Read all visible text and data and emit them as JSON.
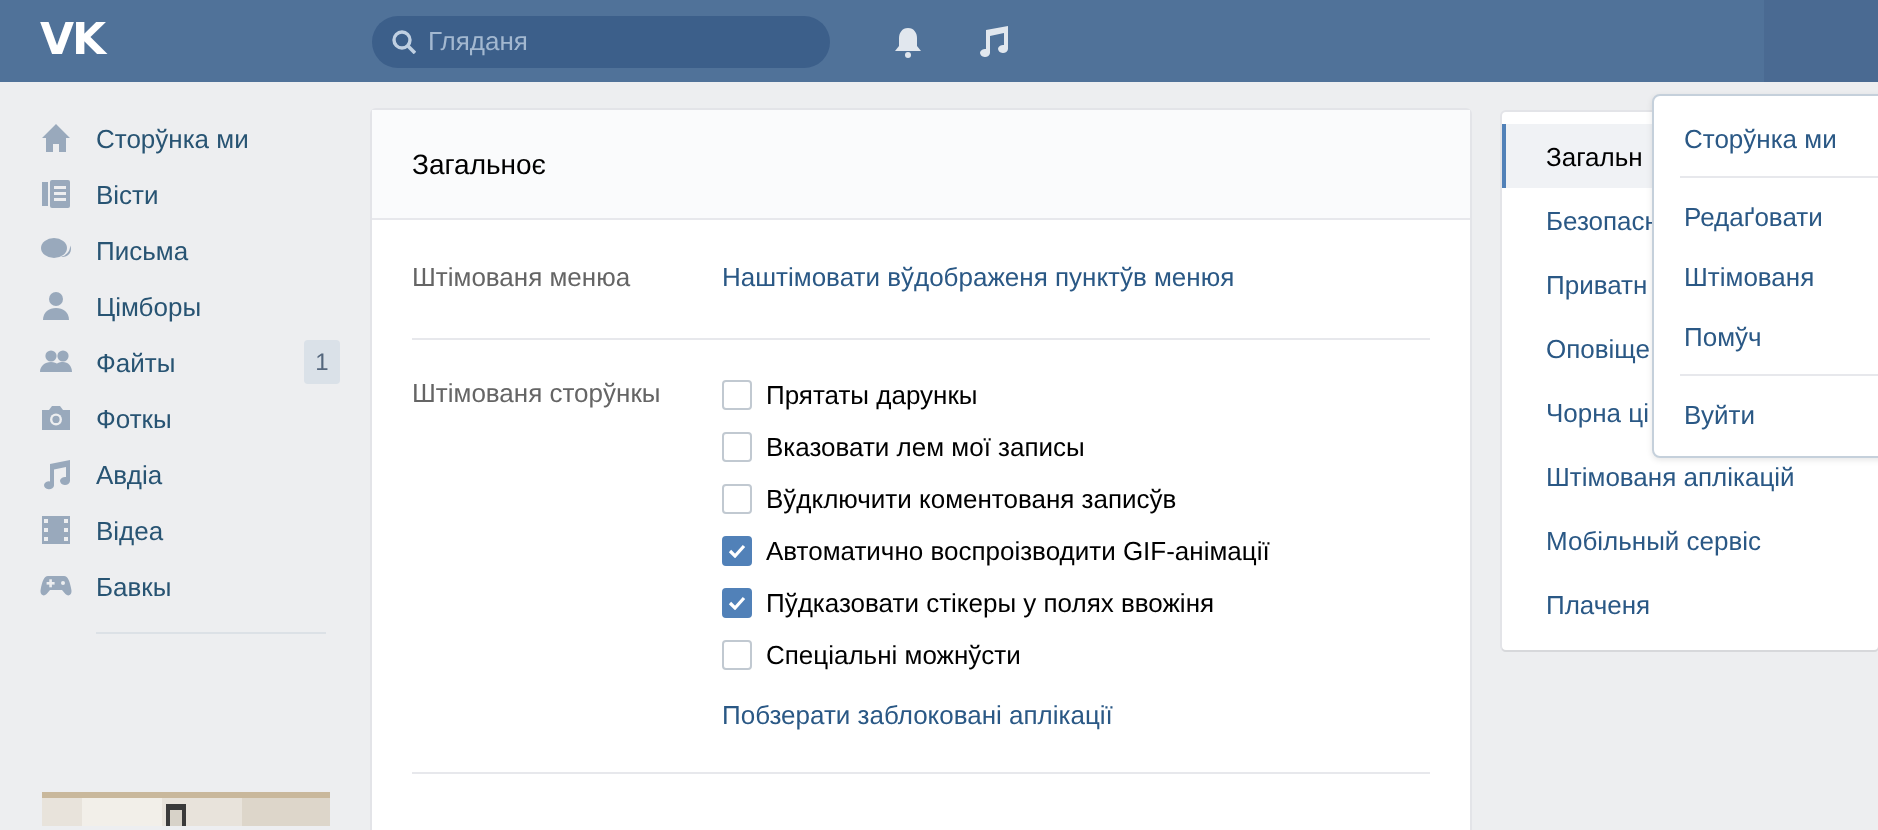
{
  "header": {
    "logo": "VK",
    "search": {
      "placeholder": "Гляданя"
    }
  },
  "sidebar": {
    "items": [
      {
        "label": "Сторўнка ми"
      },
      {
        "label": "Вісти"
      },
      {
        "label": "Письма"
      },
      {
        "label": "Цімборы"
      },
      {
        "label": "Файты",
        "badge": "1"
      },
      {
        "label": "Фоткы"
      },
      {
        "label": "Авдіа"
      },
      {
        "label": "Відеа"
      },
      {
        "label": "Бавкы"
      }
    ]
  },
  "settings": {
    "title": "Загальноє",
    "rows": [
      {
        "kind": "link",
        "label": "Штімованя менюа",
        "link": "Наштімовати вўдображеня пунктўв менюя"
      },
      {
        "kind": "checks",
        "label": "Штімованя сторўнкы",
        "options": [
          {
            "label": "Прятаты дарункы",
            "checked": false
          },
          {
            "label": "Вказовати лем мої записы",
            "checked": false
          },
          {
            "label": "Вўдключити коментованя записўв",
            "checked": false
          },
          {
            "label": "Автоматично воспроізводити GIF-анімації",
            "checked": true
          },
          {
            "label": "Пўдказовати стікеры у полях ввожіня",
            "checked": true
          },
          {
            "label": "Спеціальні можнўсти",
            "checked": false
          }
        ],
        "link": "Побзерати заблоковані аплікації"
      }
    ]
  },
  "nav": {
    "items": [
      {
        "label": "Загальн",
        "selected": true
      },
      {
        "label": "Безопасн",
        "selected": false
      },
      {
        "label": "Приватн",
        "selected": false
      },
      {
        "label": "Оповіще",
        "selected": false
      },
      {
        "label": "Чорна ці",
        "selected": false
      },
      {
        "label": "Штімованя аплікацій",
        "selected": false
      },
      {
        "label": "Мобільный сервіс",
        "selected": false
      },
      {
        "label": "Плаченя",
        "selected": false
      }
    ]
  },
  "menu": {
    "groups": [
      {
        "items": [
          "Сторўнка ми"
        ]
      },
      {
        "items": [
          "Редаґовати",
          "Штімованя",
          "Помўч"
        ]
      },
      {
        "items": [
          "Вуйти"
        ]
      }
    ]
  }
}
